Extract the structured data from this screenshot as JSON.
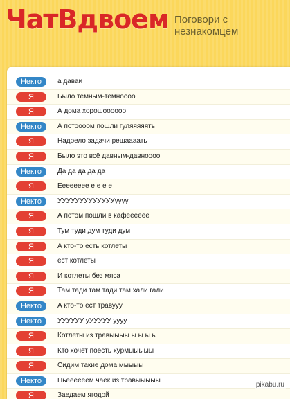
{
  "header": {
    "logo": "ЧатВдвоем",
    "tagline": "Поговори с незнакомцем"
  },
  "watermark": "pikabu.ru",
  "colors": {
    "me_badge": "#e34033",
    "stranger_badge": "#3487c7",
    "logo": "#d92727",
    "background": "#fbd75b"
  },
  "messages": [
    {
      "sender": "Некто",
      "text": "а даваи"
    },
    {
      "sender": "Я",
      "text": "Было темным-темноооо"
    },
    {
      "sender": "Я",
      "text": "А дома хорошоооооо"
    },
    {
      "sender": "Некто",
      "text": "А потоооом пошли гуляяяяять"
    },
    {
      "sender": "Я",
      "text": "Надоело задачи решаааать"
    },
    {
      "sender": "Я",
      "text": "Было это всё давным-давноооо"
    },
    {
      "sender": "Некто",
      "text": "Да да да да да"
    },
    {
      "sender": "Я",
      "text": "Ееееееее е е е е"
    },
    {
      "sender": "Некто",
      "text": "УУУУУУУУУУУУУуууу"
    },
    {
      "sender": "Я",
      "text": "А потом пошли в кафееееее"
    },
    {
      "sender": "Я",
      "text": "Тум туди дум туди дум"
    },
    {
      "sender": "Я",
      "text": "А кто-то есть котлеты"
    },
    {
      "sender": "Я",
      "text": "ест котлеты"
    },
    {
      "sender": "Я",
      "text": "И котлеты без мяса"
    },
    {
      "sender": "Я",
      "text": "Там тади там тади там хали гали"
    },
    {
      "sender": "Некто",
      "text": "А кто-то ест травууу"
    },
    {
      "sender": "Некто",
      "text": "УУУУУУ уУУУУУ уууу"
    },
    {
      "sender": "Я",
      "text": "Котлеты из травыыыы ы ы ы ы"
    },
    {
      "sender": "Я",
      "text": "Кто хочет поесть хурмыыыыы"
    },
    {
      "sender": "Я",
      "text": "Сидим такие дома мыыыы"
    },
    {
      "sender": "Некто",
      "text": "Пьёёёёёём чаёк из травыыыыы"
    },
    {
      "sender": "Я",
      "text": "Заедаем ягодой"
    }
  ]
}
